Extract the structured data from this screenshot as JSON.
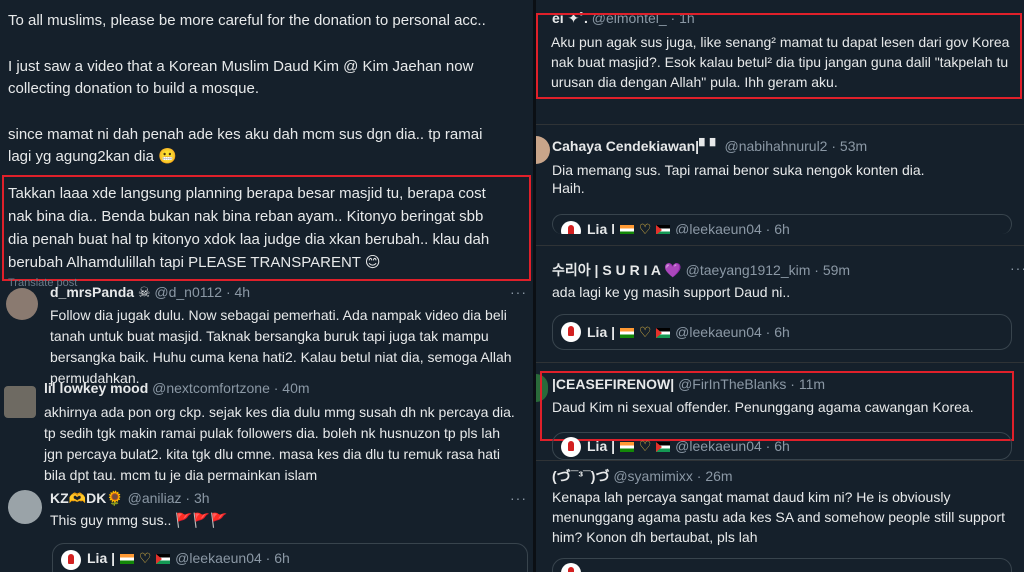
{
  "main_post": {
    "lines": [
      "To all muslims, please be more careful for the donation to personal acc..",
      "I just saw a video that a Korean Muslim Daud Kim @ Kim Jaehan now",
      "collecting donation to build a mosque.",
      "since mamat ni dah penah ade kes aku dah mcm sus dgn dia.. tp ramai",
      "lagi yg agung2kan dia 😬",
      "Takkan laaa xde langsung planning berapa besar masjid tu, berapa cost",
      "nak bina dia.. Benda bukan nak bina reban ayam.. Kitonyo beringat sbb",
      "dia penah buat hal tp kitonyo xdok laa judge dia xkan berubah.. klau dah",
      "berubah Alhamdulillah tapi PLEASE TRANSPARENT 😊"
    ],
    "translate_label": "Translate post"
  },
  "left_replies": [
    {
      "name": "d_mrsPanda ☠",
      "handle": "@d_n0112 · 4h",
      "lines": [
        "Follow dia jugak dulu. Now sebagai pemerhati. Ada nampak video dia beli",
        "tanah untuk buat masjid. Taknak bersangka buruk tapi juga tak mampu",
        "bersangka baik. Huhu cuma kena hati2. Kalau betul niat dia, semoga Allah",
        "permudahkan."
      ],
      "more": "···"
    },
    {
      "name": "lil lowkey mood",
      "handle": "@nextcomfortzone · 40m",
      "lines": [
        "akhirnya ada pon org ckp. sejak kes dia dulu mmg susah dh nk percaya dia.",
        "tp sedih tgk makin ramai pulak followers dia. boleh nk husnuzon tp pls lah",
        "jgn percaya bulat2. kita tgk dlu cmne. masa kes dia dlu tu remuk rasa hati",
        "bila dpt tau. mcm tu je dia permainkan islam"
      ],
      "more": "···"
    },
    {
      "name": "KZ🫶DK🌻",
      "handle": "@aniliaz · 3h",
      "lines": [
        "This guy mmg sus.. 🚩🚩🚩"
      ],
      "more": "···"
    }
  ],
  "left_quote": {
    "name": "Lia |",
    "handle": "@leekaeun04 · 6h"
  },
  "right_replies": [
    {
      "name": "ei ✦˚.",
      "handle": "@elmontel_ · 1h",
      "lines": [
        "Aku pun agak sus juga, like senang² mamat tu dapat lesen dari gov Korea",
        "nak buat masjid?. Esok kalau betul² dia tipu jangan guna dalil \"takpelah tu",
        "urusan dia dengan Allah\" pula. Ihh geram aku."
      ]
    },
    {
      "name": "Cahaya Cendekiawan|▘▘",
      "handle": "@nabihahnurul2 · 53m",
      "lines": [
        "Dia memang sus. Tapi ramai benor suka nengok konten dia.",
        "Haih."
      ]
    },
    {
      "name": "수리아 | S U R I A 💜",
      "handle": "@taeyang1912_kim · 59m",
      "lines": [
        "ada lagi ke yg masih support Daud ni.."
      ]
    },
    {
      "name": "|CEASEFIRENOW|",
      "handle": "@FirInTheBlanks · 11m",
      "lines": [
        "Daud Kim ni sexual offender. Penunggang agama cawangan Korea."
      ]
    },
    {
      "name": "(づ¯³¯)づ",
      "handle": "@syamimixx · 26m",
      "lines": [
        "Kenapa lah percaya sangat mamat daud kim ni? He is obviously",
        "menunggang agama pastu ada kes SA and somehow people still support",
        "him? Konon dh bertaubat, pls lah"
      ]
    }
  ],
  "right_quote": {
    "name": "Lia |",
    "handle": "@leekaeun04 · 6h"
  },
  "colors": {
    "highlight": "#e0202a",
    "background": "#15202b"
  }
}
